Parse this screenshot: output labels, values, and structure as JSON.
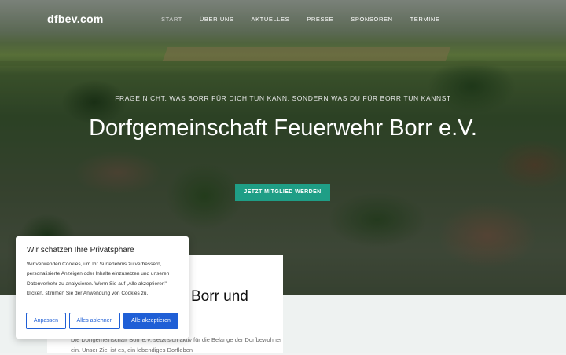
{
  "nav": {
    "logo": "dfbev.com",
    "items": [
      "START",
      "ÜBER UNS",
      "AKTUELLES",
      "PRESSE",
      "SPONSOREN",
      "TERMINE"
    ]
  },
  "hero": {
    "tagline": "FRAGE NICHT, WAS BORR FÜR DICH TUN KANN, SONDERN WAS DU FÜR BORR TUN KANNST",
    "title": "Dorfgemeinschaft Feuerwehr Borr e.V.",
    "cta_label": "JETZT MITGLIED WERDEN"
  },
  "about": {
    "heading_partial": "Borr und",
    "text_partial": "Die Dorfgemeinschaft Borr e.V. setzt sich aktiv für die Belange der Dorfbewohner ein. Unser Ziel ist es, ein lebendiges Dorfleben"
  },
  "cookie": {
    "title": "Wir schätzen Ihre Privatsphäre",
    "body": "Wir verwenden Cookies, um Ihr Surferlebnis zu verbessern, personalisierte Anzeigen oder Inhalte einzusetzen und unseren Datenverkehr zu analysieren. Wenn Sie auf „Alle akzeptieren\" klicken, stimmen Sie der Anwendung von Cookies zu.",
    "customize_label": "Anpassen",
    "reject_label": "Alles ablehnen",
    "accept_label": "Alle akzeptieren"
  },
  "colors": {
    "accent": "#1f9e86",
    "cookie_button": "#1f5fd6"
  }
}
